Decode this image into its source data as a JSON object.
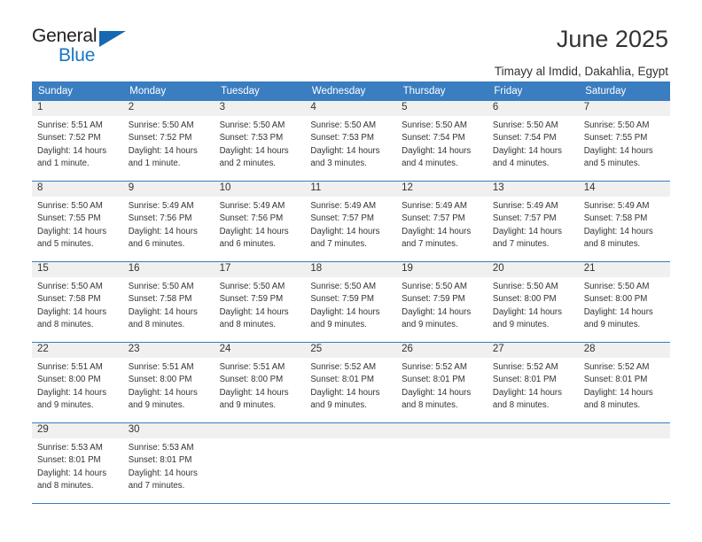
{
  "logo": {
    "word1": "General",
    "word2": "Blue",
    "triangle_color": "#1668b3",
    "blue_color": "#1877c4"
  },
  "header": {
    "title": "June 2025",
    "subtitle": "Timayy al Imdid, Dakahlia, Egypt"
  },
  "theme": {
    "header_bg": "#3a7dc0",
    "daynum_bg": "#f0f0f0",
    "text": "#333333"
  },
  "weekdays": [
    "Sunday",
    "Monday",
    "Tuesday",
    "Wednesday",
    "Thursday",
    "Friday",
    "Saturday"
  ],
  "weeks": [
    [
      {
        "day": "1",
        "sunrise": "Sunrise: 5:51 AM",
        "sunset": "Sunset: 7:52 PM",
        "daylight": "Daylight: 14 hours and 1 minute."
      },
      {
        "day": "2",
        "sunrise": "Sunrise: 5:50 AM",
        "sunset": "Sunset: 7:52 PM",
        "daylight": "Daylight: 14 hours and 1 minute."
      },
      {
        "day": "3",
        "sunrise": "Sunrise: 5:50 AM",
        "sunset": "Sunset: 7:53 PM",
        "daylight": "Daylight: 14 hours and 2 minutes."
      },
      {
        "day": "4",
        "sunrise": "Sunrise: 5:50 AM",
        "sunset": "Sunset: 7:53 PM",
        "daylight": "Daylight: 14 hours and 3 minutes."
      },
      {
        "day": "5",
        "sunrise": "Sunrise: 5:50 AM",
        "sunset": "Sunset: 7:54 PM",
        "daylight": "Daylight: 14 hours and 4 minutes."
      },
      {
        "day": "6",
        "sunrise": "Sunrise: 5:50 AM",
        "sunset": "Sunset: 7:54 PM",
        "daylight": "Daylight: 14 hours and 4 minutes."
      },
      {
        "day": "7",
        "sunrise": "Sunrise: 5:50 AM",
        "sunset": "Sunset: 7:55 PM",
        "daylight": "Daylight: 14 hours and 5 minutes."
      }
    ],
    [
      {
        "day": "8",
        "sunrise": "Sunrise: 5:50 AM",
        "sunset": "Sunset: 7:55 PM",
        "daylight": "Daylight: 14 hours and 5 minutes."
      },
      {
        "day": "9",
        "sunrise": "Sunrise: 5:49 AM",
        "sunset": "Sunset: 7:56 PM",
        "daylight": "Daylight: 14 hours and 6 minutes."
      },
      {
        "day": "10",
        "sunrise": "Sunrise: 5:49 AM",
        "sunset": "Sunset: 7:56 PM",
        "daylight": "Daylight: 14 hours and 6 minutes."
      },
      {
        "day": "11",
        "sunrise": "Sunrise: 5:49 AM",
        "sunset": "Sunset: 7:57 PM",
        "daylight": "Daylight: 14 hours and 7 minutes."
      },
      {
        "day": "12",
        "sunrise": "Sunrise: 5:49 AM",
        "sunset": "Sunset: 7:57 PM",
        "daylight": "Daylight: 14 hours and 7 minutes."
      },
      {
        "day": "13",
        "sunrise": "Sunrise: 5:49 AM",
        "sunset": "Sunset: 7:57 PM",
        "daylight": "Daylight: 14 hours and 7 minutes."
      },
      {
        "day": "14",
        "sunrise": "Sunrise: 5:49 AM",
        "sunset": "Sunset: 7:58 PM",
        "daylight": "Daylight: 14 hours and 8 minutes."
      }
    ],
    [
      {
        "day": "15",
        "sunrise": "Sunrise: 5:50 AM",
        "sunset": "Sunset: 7:58 PM",
        "daylight": "Daylight: 14 hours and 8 minutes."
      },
      {
        "day": "16",
        "sunrise": "Sunrise: 5:50 AM",
        "sunset": "Sunset: 7:58 PM",
        "daylight": "Daylight: 14 hours and 8 minutes."
      },
      {
        "day": "17",
        "sunrise": "Sunrise: 5:50 AM",
        "sunset": "Sunset: 7:59 PM",
        "daylight": "Daylight: 14 hours and 8 minutes."
      },
      {
        "day": "18",
        "sunrise": "Sunrise: 5:50 AM",
        "sunset": "Sunset: 7:59 PM",
        "daylight": "Daylight: 14 hours and 9 minutes."
      },
      {
        "day": "19",
        "sunrise": "Sunrise: 5:50 AM",
        "sunset": "Sunset: 7:59 PM",
        "daylight": "Daylight: 14 hours and 9 minutes."
      },
      {
        "day": "20",
        "sunrise": "Sunrise: 5:50 AM",
        "sunset": "Sunset: 8:00 PM",
        "daylight": "Daylight: 14 hours and 9 minutes."
      },
      {
        "day": "21",
        "sunrise": "Sunrise: 5:50 AM",
        "sunset": "Sunset: 8:00 PM",
        "daylight": "Daylight: 14 hours and 9 minutes."
      }
    ],
    [
      {
        "day": "22",
        "sunrise": "Sunrise: 5:51 AM",
        "sunset": "Sunset: 8:00 PM",
        "daylight": "Daylight: 14 hours and 9 minutes."
      },
      {
        "day": "23",
        "sunrise": "Sunrise: 5:51 AM",
        "sunset": "Sunset: 8:00 PM",
        "daylight": "Daylight: 14 hours and 9 minutes."
      },
      {
        "day": "24",
        "sunrise": "Sunrise: 5:51 AM",
        "sunset": "Sunset: 8:00 PM",
        "daylight": "Daylight: 14 hours and 9 minutes."
      },
      {
        "day": "25",
        "sunrise": "Sunrise: 5:52 AM",
        "sunset": "Sunset: 8:01 PM",
        "daylight": "Daylight: 14 hours and 9 minutes."
      },
      {
        "day": "26",
        "sunrise": "Sunrise: 5:52 AM",
        "sunset": "Sunset: 8:01 PM",
        "daylight": "Daylight: 14 hours and 8 minutes."
      },
      {
        "day": "27",
        "sunrise": "Sunrise: 5:52 AM",
        "sunset": "Sunset: 8:01 PM",
        "daylight": "Daylight: 14 hours and 8 minutes."
      },
      {
        "day": "28",
        "sunrise": "Sunrise: 5:52 AM",
        "sunset": "Sunset: 8:01 PM",
        "daylight": "Daylight: 14 hours and 8 minutes."
      }
    ],
    [
      {
        "day": "29",
        "sunrise": "Sunrise: 5:53 AM",
        "sunset": "Sunset: 8:01 PM",
        "daylight": "Daylight: 14 hours and 8 minutes."
      },
      {
        "day": "30",
        "sunrise": "Sunrise: 5:53 AM",
        "sunset": "Sunset: 8:01 PM",
        "daylight": "Daylight: 14 hours and 7 minutes."
      },
      null,
      null,
      null,
      null,
      null
    ]
  ]
}
